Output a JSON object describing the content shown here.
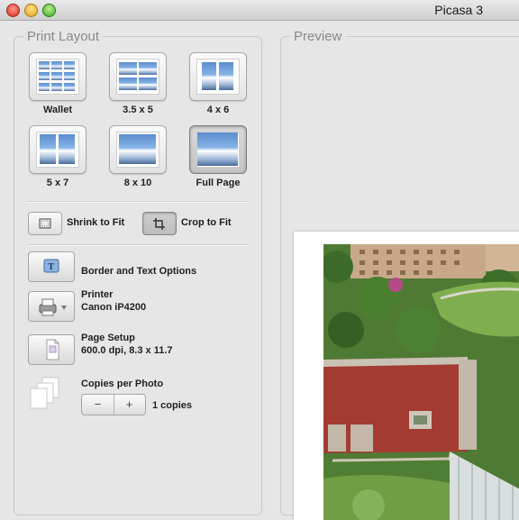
{
  "window": {
    "title": "Picasa 3"
  },
  "left_panel": {
    "title": "Print Layout",
    "layouts": [
      {
        "label": "Wallet"
      },
      {
        "label": "3.5 x 5"
      },
      {
        "label": "4 x 6"
      },
      {
        "label": "5 x 7"
      },
      {
        "label": "8 x 10"
      },
      {
        "label": "Full Page",
        "selected": true
      }
    ],
    "fit": {
      "shrink_label": "Shrink to Fit",
      "crop_label": "Crop to Fit",
      "selected": "crop"
    },
    "border": {
      "title": "Border and Text Options"
    },
    "printer": {
      "title": "Printer",
      "name": "Canon iP4200"
    },
    "page_setup": {
      "title": "Page Setup",
      "details": "600.0 dpi, 8.3 x 11.7"
    },
    "copies": {
      "title": "Copies per Photo",
      "minus": "−",
      "plus": "+",
      "count_text": "1 copies"
    }
  },
  "right_panel": {
    "title": "Preview"
  },
  "colors": {
    "panel_bg": "#e6e6e6",
    "border": "#c9c9c9",
    "legend": "#8a8a8a"
  }
}
